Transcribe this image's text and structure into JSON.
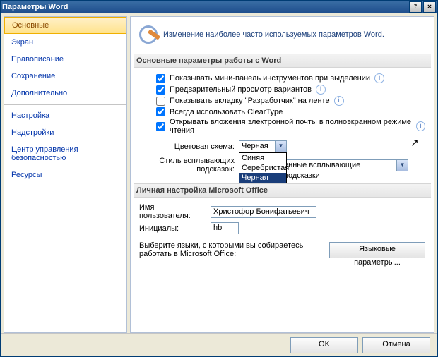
{
  "window": {
    "title": "Параметры Word"
  },
  "sidebar": {
    "items": [
      {
        "label": "Основные",
        "selected": true
      },
      {
        "label": "Экран"
      },
      {
        "label": "Правописание"
      },
      {
        "label": "Сохранение"
      },
      {
        "label": "Дополнительно"
      },
      {
        "label": "Настройка",
        "sep": true
      },
      {
        "label": "Надстройки"
      },
      {
        "label": "Центр управления безопасностью"
      },
      {
        "label": "Ресурсы"
      }
    ]
  },
  "header": {
    "text": "Изменение наиболее часто используемых параметров Word."
  },
  "section1": {
    "title": "Основные параметры работы с Word",
    "opts": [
      {
        "label": "Показывать мини-панель инструментов при выделении",
        "checked": true,
        "info": true
      },
      {
        "label": "Предварительный просмотр вариантов",
        "checked": true,
        "info": true
      },
      {
        "label": "Показывать вкладку \"Разработчик\" на ленте",
        "checked": false,
        "info": true
      },
      {
        "label": "Всегда использовать ClearType",
        "checked": true
      },
      {
        "label": "Открывать вложения электронной почты в полноэкранном режиме чтения",
        "checked": true,
        "info": true
      }
    ],
    "color_scheme": {
      "label": "Цветовая схема:",
      "value": "Черная",
      "options": [
        "Синяя",
        "Серебристая",
        "Черная"
      ],
      "selected_index": 2
    },
    "tooltip_style": {
      "label": "Стиль всплывающих подсказок:",
      "value": "енные всплывающие подсказки"
    }
  },
  "section2": {
    "title": "Личная настройка Microsoft Office",
    "username": {
      "label": "Имя пользователя:",
      "value": "Христофор Бонифатьевич"
    },
    "initials": {
      "label": "Инициалы:",
      "value": "hb"
    },
    "lang_hint": "Выберите языки, с которыми вы собираетесь работать в Microsoft Office:",
    "lang_btn": "Языковые параметры..."
  },
  "footer": {
    "ok": "OK",
    "cancel": "Отмена"
  }
}
